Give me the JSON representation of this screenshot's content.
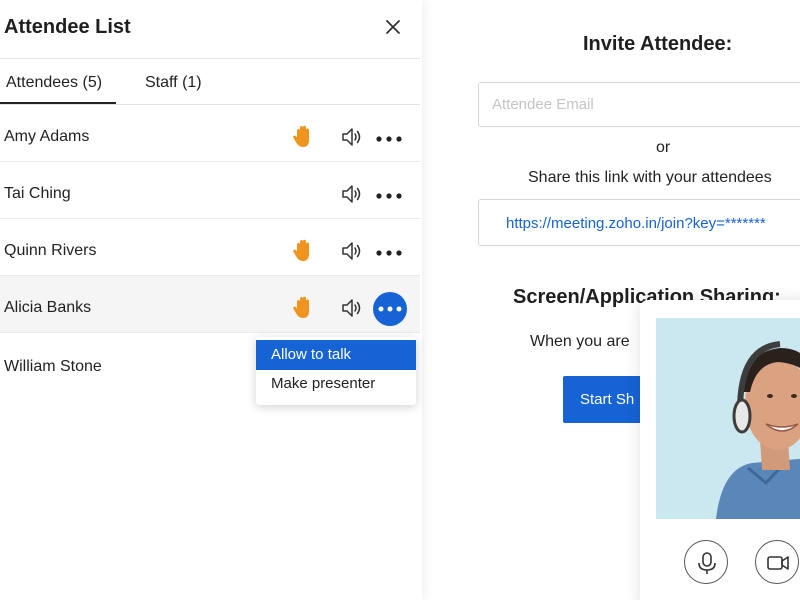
{
  "panel": {
    "title": "Attendee List",
    "tabs": [
      {
        "label": "Attendees (5)",
        "active": true
      },
      {
        "label": "Staff (1)",
        "active": false
      }
    ]
  },
  "attendees": [
    {
      "name": "Amy Adams",
      "hand_raised": true
    },
    {
      "name": "Tai Ching",
      "hand_raised": false
    },
    {
      "name": "Quinn Rivers",
      "hand_raised": true
    },
    {
      "name": "Alicia Banks",
      "hand_raised": true,
      "menu_open": true
    },
    {
      "name": "William Stone",
      "hand_raised": false
    }
  ],
  "row_menu": {
    "items": [
      "Allow to talk",
      "Make presenter"
    ],
    "highlighted": "Allow to talk"
  },
  "invite": {
    "title": "Invite Attendee:",
    "email_placeholder": "Attendee Email",
    "or_text": "or",
    "share_text": "Share this link with your attendees",
    "link": "https://meeting.zoho.in/join?key=*******"
  },
  "screen_sharing": {
    "title": "Screen/Application Sharing:",
    "description": "When you are",
    "button_label": "Start Sh"
  },
  "video": {
    "controls": [
      "microphone-icon",
      "camera-icon"
    ]
  },
  "colors": {
    "accent": "#1663d6",
    "hand": "#f0941f",
    "active_row": "#f5f5f6"
  }
}
